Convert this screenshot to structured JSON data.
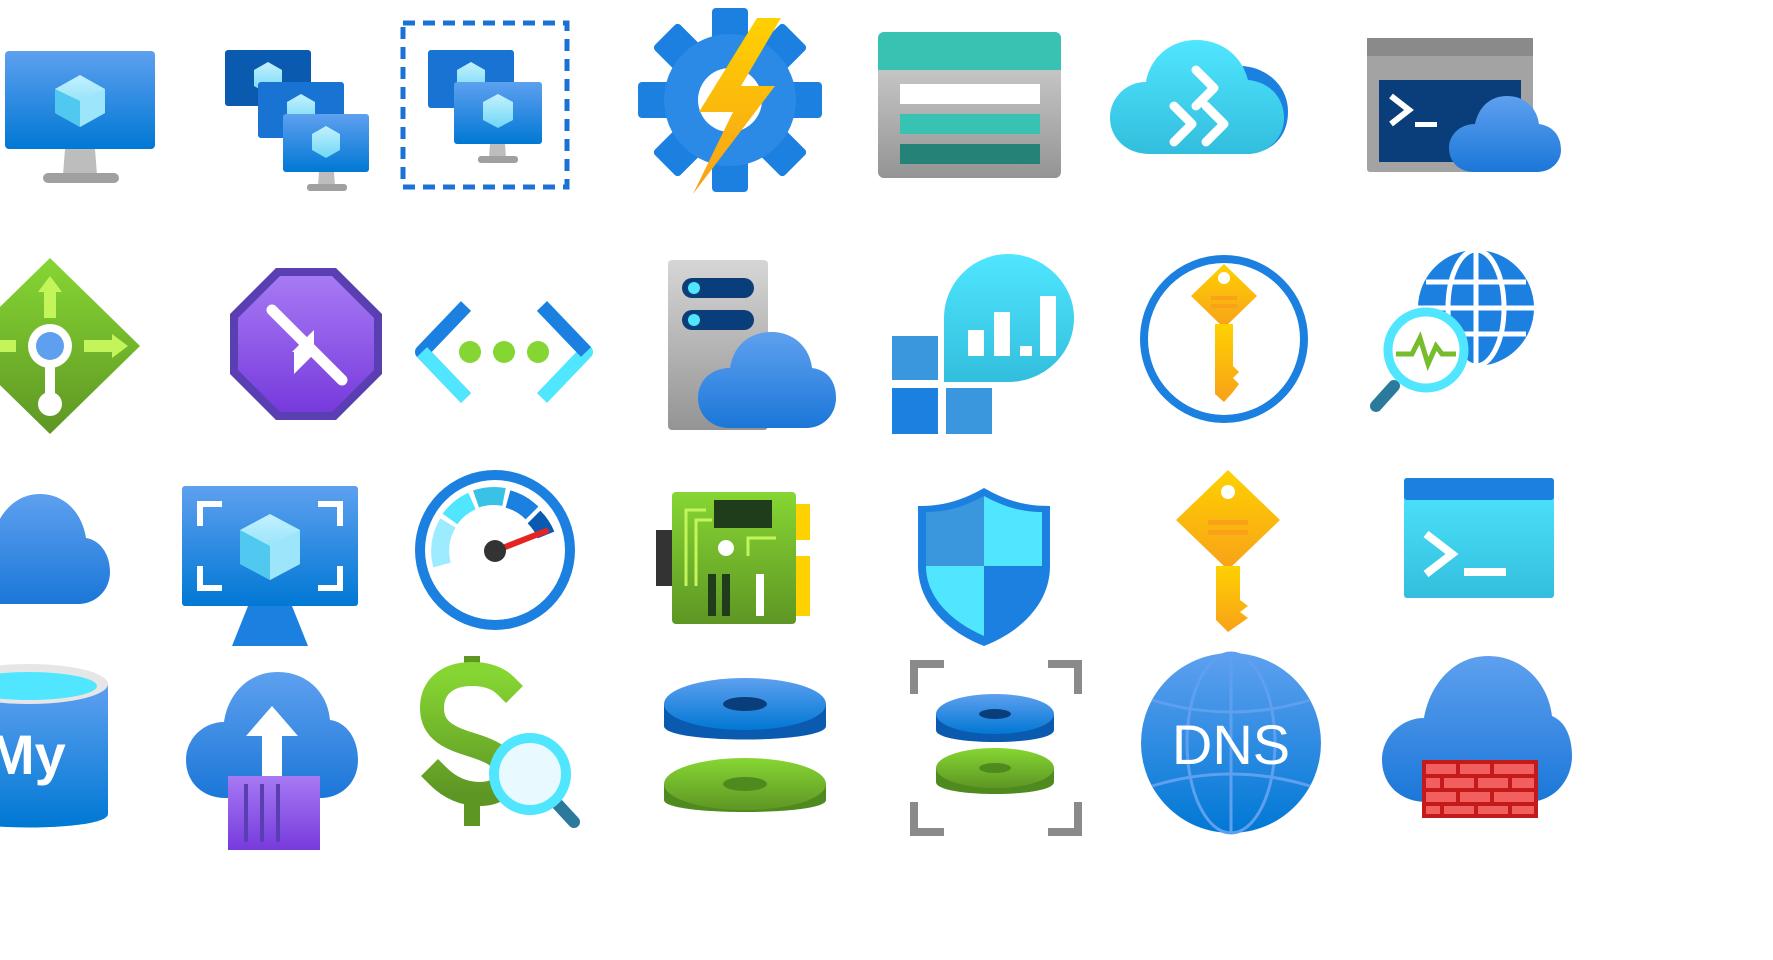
{
  "sheet": {
    "icons": [
      {
        "name": "virtual-machine-icon"
      },
      {
        "name": "vm-scale-sets-icon"
      },
      {
        "name": "availability-set-icon"
      },
      {
        "name": "automation-account-icon"
      },
      {
        "name": "storage-table-icon"
      },
      {
        "name": "azure-migrate-icon"
      },
      {
        "name": "cloud-shell-icon"
      },
      {
        "name": "network-gateway-icon"
      },
      {
        "name": "route-table-icon"
      },
      {
        "name": "private-link-icon"
      },
      {
        "name": "cloud-server-icon"
      },
      {
        "name": "application-insights-apps-icon"
      },
      {
        "name": "key-vault-icon"
      },
      {
        "name": "network-watcher-icon"
      },
      {
        "name": "cloud-icon"
      },
      {
        "name": "vm-image-icon"
      },
      {
        "name": "speedometer-icon"
      },
      {
        "name": "circuit-board-icon"
      },
      {
        "name": "security-shield-icon"
      },
      {
        "name": "key-icon"
      },
      {
        "name": "console-icon"
      },
      {
        "name": "mysql-database-icon"
      },
      {
        "name": "container-upload-icon"
      },
      {
        "name": "cost-analysis-icon"
      },
      {
        "name": "disks-icon"
      },
      {
        "name": "disk-snapshot-icon"
      },
      {
        "name": "dns-zone-icon"
      },
      {
        "name": "firewall-icon"
      }
    ]
  },
  "labels": {
    "dns": "DNS",
    "mysql": "My"
  },
  "colors": {
    "azure_blue": "#0078d4",
    "light_blue": "#50e6ff",
    "green": "#86d633",
    "purple": "#8661c5",
    "yellow": "#ffca00",
    "teal": "#37c2b1",
    "red": "#e62323"
  }
}
